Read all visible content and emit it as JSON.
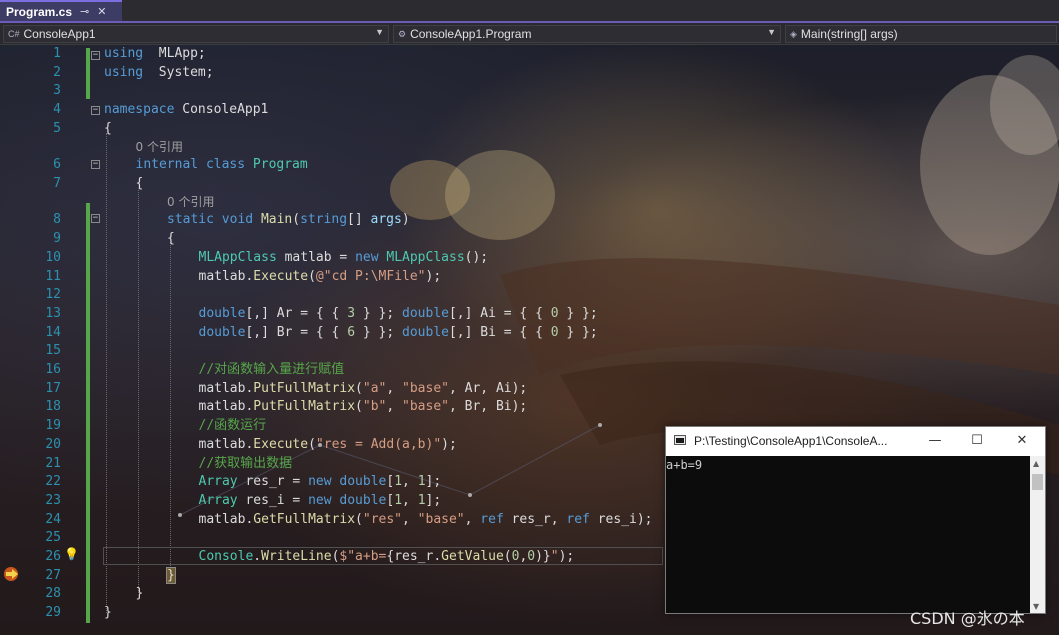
{
  "tab": {
    "title": "Program.cs",
    "pin_icon": "pin-icon",
    "close_icon": "close-icon"
  },
  "navbar": {
    "project": "ConsoleApp1",
    "project_icon": "csharp-project-icon",
    "type": "ConsoleApp1.Program",
    "type_icon": "class-icon",
    "member": "Main(string[] args)",
    "member_icon": "method-icon"
  },
  "editor": {
    "codelens": [
      {
        "after_line": 5,
        "text": "0 个引用"
      },
      {
        "after_line": 7,
        "text": "0 个引用"
      }
    ],
    "lines": [
      {
        "n": "1",
        "tokens": [
          [
            "kw",
            "using"
          ],
          [
            "",
            "  MLApp;"
          ]
        ]
      },
      {
        "n": "2",
        "tokens": [
          [
            "kw",
            "using"
          ],
          [
            "",
            "  System;"
          ]
        ]
      },
      {
        "n": "3",
        "tokens": []
      },
      {
        "n": "4",
        "tokens": [
          [
            "kw",
            "namespace"
          ],
          [
            "",
            " ConsoleApp1"
          ]
        ]
      },
      {
        "n": "5",
        "tokens": [
          [
            "",
            "{"
          ]
        ]
      },
      {
        "n": "6",
        "tokens": [
          [
            "kw",
            "internal"
          ],
          [
            "",
            " "
          ],
          [
            "kw",
            "class"
          ],
          [
            "",
            " "
          ],
          [
            "ty",
            "Program"
          ]
        ]
      },
      {
        "n": "7",
        "tokens": [
          [
            "",
            "{"
          ]
        ]
      },
      {
        "n": "8",
        "tokens": [
          [
            "kw",
            "static"
          ],
          [
            "",
            " "
          ],
          [
            "kw",
            "void"
          ],
          [
            "",
            " "
          ],
          [
            "fn",
            "Main"
          ],
          [
            "",
            "("
          ],
          [
            "kw",
            "string"
          ],
          [
            "",
            "[] "
          ],
          [
            "vr",
            "args"
          ],
          [
            "",
            ")"
          ]
        ]
      },
      {
        "n": "9",
        "tokens": [
          [
            "",
            "{"
          ]
        ]
      },
      {
        "n": "10",
        "tokens": [
          [
            "ty",
            "MLAppClass"
          ],
          [
            "",
            " matlab = "
          ],
          [
            "kw",
            "new"
          ],
          [
            "",
            " "
          ],
          [
            "ty",
            "MLAppClass"
          ],
          [
            "",
            "();"
          ]
        ]
      },
      {
        "n": "11",
        "tokens": [
          [
            "",
            "matlab."
          ],
          [
            "fn",
            "Execute"
          ],
          [
            "",
            "("
          ],
          [
            "st",
            "@\"cd P:\\MFile\""
          ],
          [
            "",
            ");"
          ]
        ]
      },
      {
        "n": "12",
        "tokens": []
      },
      {
        "n": "13",
        "tokens": [
          [
            "kw",
            "double"
          ],
          [
            "",
            "[,] Ar = { { "
          ],
          [
            "nm",
            "3"
          ],
          [
            "",
            " } }; "
          ],
          [
            "kw",
            "double"
          ],
          [
            "",
            "[,] Ai = { { "
          ],
          [
            "nm",
            "0"
          ],
          [
            "",
            " } };"
          ]
        ]
      },
      {
        "n": "14",
        "tokens": [
          [
            "kw",
            "double"
          ],
          [
            "",
            "[,] Br = { { "
          ],
          [
            "nm",
            "6"
          ],
          [
            "",
            " } }; "
          ],
          [
            "kw",
            "double"
          ],
          [
            "",
            "[,] Bi = { { "
          ],
          [
            "nm",
            "0"
          ],
          [
            "",
            " } };"
          ]
        ]
      },
      {
        "n": "15",
        "tokens": []
      },
      {
        "n": "16",
        "tokens": [
          [
            "cm",
            "//对函数输入量进行赋值"
          ]
        ]
      },
      {
        "n": "17",
        "tokens": [
          [
            "",
            "matlab."
          ],
          [
            "fn",
            "PutFullMatrix"
          ],
          [
            "",
            "("
          ],
          [
            "st",
            "\"a\""
          ],
          [
            "",
            ", "
          ],
          [
            "st",
            "\"base\""
          ],
          [
            "",
            ", Ar, Ai);"
          ]
        ]
      },
      {
        "n": "18",
        "tokens": [
          [
            "",
            "matlab."
          ],
          [
            "fn",
            "PutFullMatrix"
          ],
          [
            "",
            "("
          ],
          [
            "st",
            "\"b\""
          ],
          [
            "",
            ", "
          ],
          [
            "st",
            "\"base\""
          ],
          [
            "",
            ", Br, Bi);"
          ]
        ]
      },
      {
        "n": "19",
        "tokens": [
          [
            "cm",
            "//函数运行"
          ]
        ]
      },
      {
        "n": "20",
        "tokens": [
          [
            "",
            "matlab."
          ],
          [
            "fn",
            "Execute"
          ],
          [
            "",
            "("
          ],
          [
            "st",
            "\"res = Add(a,b)\""
          ],
          [
            "",
            ");"
          ]
        ]
      },
      {
        "n": "21",
        "tokens": [
          [
            "cm",
            "//获取输出数据"
          ]
        ]
      },
      {
        "n": "22",
        "tokens": [
          [
            "ty",
            "Array"
          ],
          [
            "",
            " res_r = "
          ],
          [
            "kw",
            "new"
          ],
          [
            "",
            " "
          ],
          [
            "kw",
            "double"
          ],
          [
            "",
            "["
          ],
          [
            "nm",
            "1"
          ],
          [
            "",
            ", "
          ],
          [
            "nm",
            "1"
          ],
          [
            "",
            "];"
          ]
        ]
      },
      {
        "n": "23",
        "tokens": [
          [
            "ty",
            "Array"
          ],
          [
            "",
            " res_i = "
          ],
          [
            "kw",
            "new"
          ],
          [
            "",
            " "
          ],
          [
            "kw",
            "double"
          ],
          [
            "",
            "["
          ],
          [
            "nm",
            "1"
          ],
          [
            "",
            ", "
          ],
          [
            "nm",
            "1"
          ],
          [
            "",
            "];"
          ]
        ]
      },
      {
        "n": "24",
        "tokens": [
          [
            "",
            "matlab."
          ],
          [
            "fn",
            "GetFullMatrix"
          ],
          [
            "",
            "("
          ],
          [
            "st",
            "\"res\""
          ],
          [
            "",
            ", "
          ],
          [
            "st",
            "\"base\""
          ],
          [
            "",
            ", "
          ],
          [
            "kw",
            "ref"
          ],
          [
            "",
            " res_r, "
          ],
          [
            "kw",
            "ref"
          ],
          [
            "",
            " res_i);"
          ]
        ]
      },
      {
        "n": "25",
        "tokens": []
      },
      {
        "n": "26",
        "tokens": [
          [
            "ty",
            "Console"
          ],
          [
            "",
            "."
          ],
          [
            "fn",
            "WriteLine"
          ],
          [
            "",
            "("
          ],
          [
            "st",
            "$\"a+b="
          ],
          [
            "",
            "{res_r."
          ],
          [
            "fn",
            "GetValue"
          ],
          [
            "",
            "("
          ],
          [
            "nm",
            "0"
          ],
          [
            "",
            ","
          ],
          [
            "nm",
            "0"
          ],
          [
            "",
            ")}"
          ],
          [
            "st",
            "\""
          ],
          [
            "",
            ");"
          ]
        ]
      },
      {
        "n": "27",
        "tokens": [
          [
            "brace",
            "}"
          ]
        ]
      },
      {
        "n": "28",
        "tokens": [
          [
            "",
            "}"
          ]
        ]
      },
      {
        "n": "29",
        "tokens": [
          [
            "",
            "}"
          ]
        ]
      }
    ],
    "execution_arrow_icon": "current-statement-arrow-icon",
    "quick_action_icon": "lightbulb-icon"
  },
  "console": {
    "title": "P:\\Testing\\ConsoleApp1\\ConsoleA...",
    "output": "a+b=9",
    "minimize_icon": "minimize-icon",
    "maximize_icon": "maximize-icon",
    "close_icon": "close-icon",
    "minimize_glyph": "—",
    "maximize_glyph": "☐",
    "close_glyph": "✕"
  },
  "watermark": "CSDN @氷の本"
}
